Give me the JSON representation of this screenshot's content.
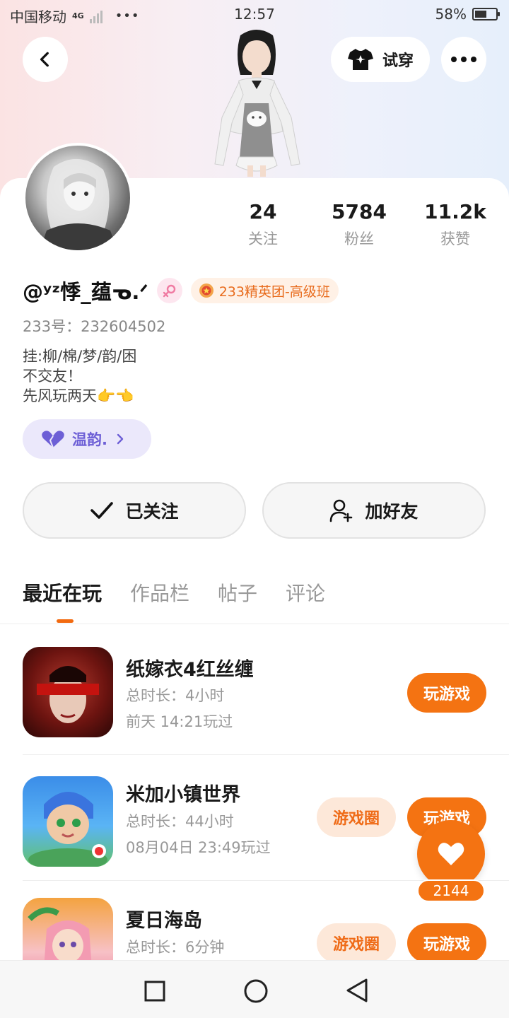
{
  "status_bar": {
    "carrier": "中国移动",
    "network": "4G",
    "dots": "•••",
    "time": "12:57",
    "battery": "58%",
    "battery_level": 0.58
  },
  "header": {
    "try_on_label": "试穿"
  },
  "stats": [
    {
      "value": "24",
      "label": "关注"
    },
    {
      "value": "5784",
      "label": "粉丝"
    },
    {
      "value": "11.2k",
      "label": "获赞"
    }
  ],
  "profile": {
    "username": "@ʸᶻ悸_蕴ᓀ.ᐟ",
    "badge": "233精英团-高级班",
    "id_line": "233号：232604502",
    "bio": [
      "挂:柳/棉/梦/韵/困",
      "不交友！",
      "先风玩两天👉👈"
    ],
    "tag": "温韵."
  },
  "actions": {
    "followed_label": "已关注",
    "add_friend_label": "加好友"
  },
  "tabs": [
    {
      "label": "最近在玩",
      "active": true
    },
    {
      "label": "作品栏",
      "active": false
    },
    {
      "label": "帖子",
      "active": false
    },
    {
      "label": "评论",
      "active": false
    }
  ],
  "games": [
    {
      "name": "纸嫁衣4红丝缠",
      "duration": "总时长：4小时",
      "last_played": "前天 14:21玩过",
      "play_label": "玩游戏",
      "circle_label": ""
    },
    {
      "name": "米加小镇世界",
      "duration": "总时长：44小时",
      "last_played": "08月04日 23:49玩过",
      "play_label": "玩游戏",
      "circle_label": "游戏圈"
    },
    {
      "name": "夏日海岛",
      "duration": "总时长：6分钟",
      "last_played": "",
      "play_label": "玩游戏",
      "circle_label": "游戏圈"
    }
  ],
  "fab": {
    "count": "2144"
  },
  "colors": {
    "accent": "#f47312",
    "tag_purple": "#6d5fd6",
    "gender_pink": "#f07aa2"
  }
}
